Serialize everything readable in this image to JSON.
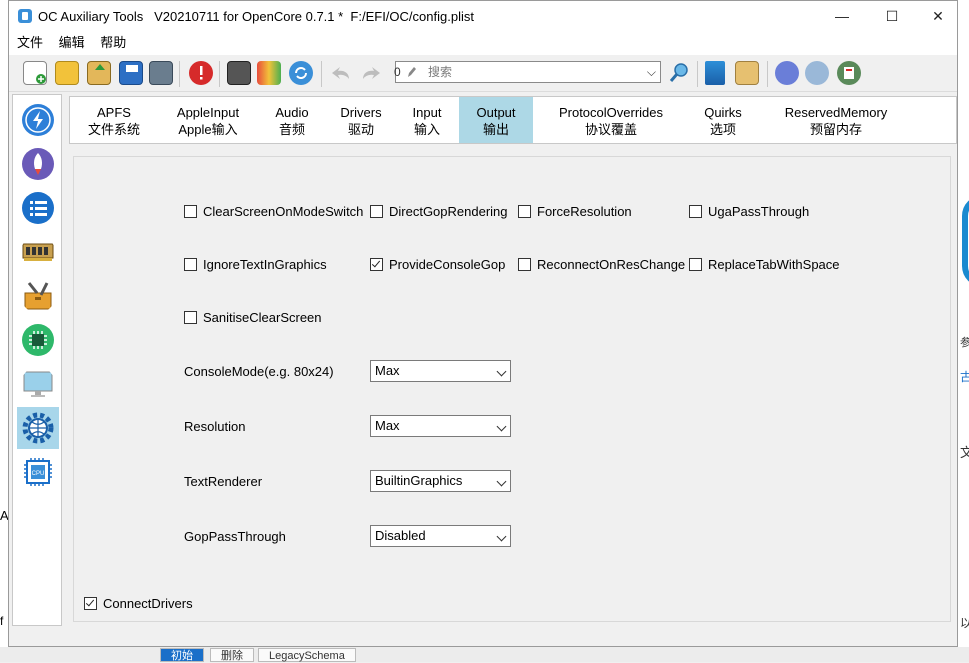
{
  "titlebar": {
    "title": "OC Auxiliary Tools   V20210711 for OpenCore 0.7.1 *  F:/EFI/OC/config.plist",
    "minimize": "—",
    "maximize": "☐",
    "close": "✕"
  },
  "menu": [
    "文件",
    "编辑",
    "帮助"
  ],
  "toolbar": {
    "search_prefix": "0",
    "search_placeholder": "搜索"
  },
  "tabs": [
    {
      "line1": "APFS",
      "line2": "文件系统"
    },
    {
      "line1": "AppleInput",
      "line2": "Apple输入"
    },
    {
      "line1": "Audio",
      "line2": "音频"
    },
    {
      "line1": "Drivers",
      "line2": "驱动"
    },
    {
      "line1": "Input",
      "line2": "输入"
    },
    {
      "line1": "Output",
      "line2": "输出"
    },
    {
      "line1": "ProtocolOverrides",
      "line2": "协议覆盖"
    },
    {
      "line1": "Quirks",
      "line2": "选项"
    },
    {
      "line1": "ReservedMemory",
      "line2": "预留内存"
    }
  ],
  "active_tab": "Output",
  "checkboxes": [
    {
      "label": "ClearScreenOnModeSwitch",
      "checked": false
    },
    {
      "label": "DirectGopRendering",
      "checked": false
    },
    {
      "label": "ForceResolution",
      "checked": false
    },
    {
      "label": "UgaPassThrough",
      "checked": false
    },
    {
      "label": "IgnoreTextInGraphics",
      "checked": false
    },
    {
      "label": "ProvideConsoleGop",
      "checked": true
    },
    {
      "label": "ReconnectOnResChange",
      "checked": false
    },
    {
      "label": "ReplaceTabWithSpace",
      "checked": false
    },
    {
      "label": "SanitiseClearScreen",
      "checked": false
    }
  ],
  "fields": [
    {
      "label": "ConsoleMode(e.g. 80x24)",
      "value": "Max"
    },
    {
      "label": "Resolution",
      "value": "Max"
    },
    {
      "label": "TextRenderer",
      "value": "BuiltinGraphics"
    },
    {
      "label": "GopPassThrough",
      "value": "Disabled"
    }
  ],
  "connect_drivers": {
    "label": "ConnectDrivers",
    "checked": true
  },
  "background": {
    "right_t1": "参",
    "right_t2": "古",
    "right_t3": "文",
    "right_t4": "以",
    "left_a": "A",
    "left_f": "f",
    "bottom_tabs": [
      "初始",
      "删除",
      "LegacySchema"
    ]
  },
  "colors": {
    "active_tab": "#add8e6",
    "active_sidebar": "#a8d6ea",
    "accent": "#1a8ad0"
  }
}
